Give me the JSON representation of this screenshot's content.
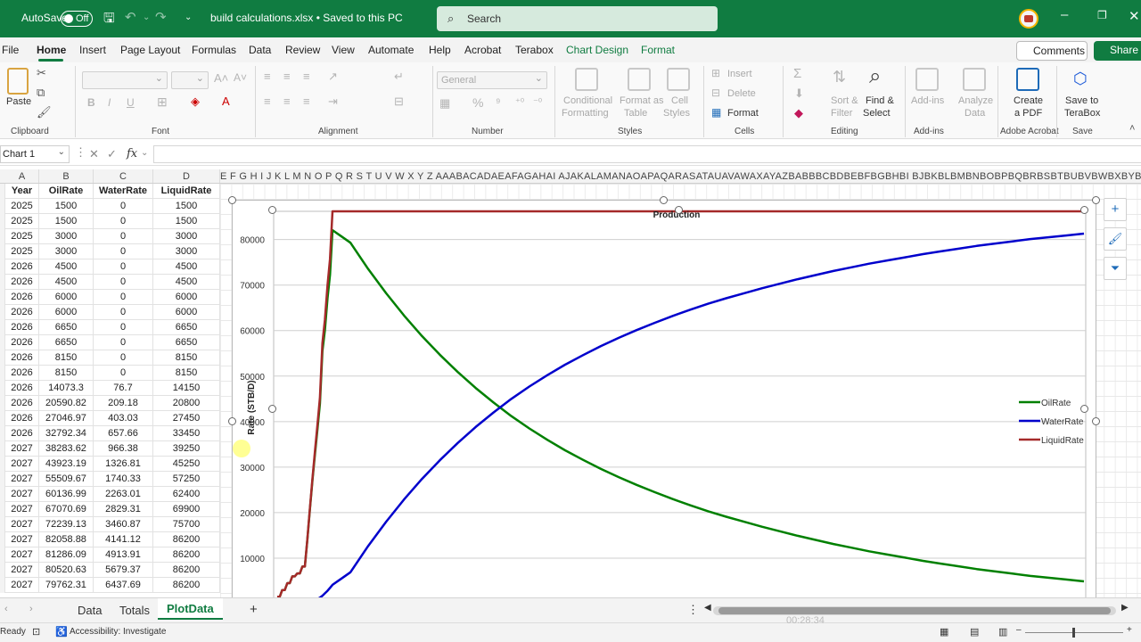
{
  "titlebar": {
    "autosave_label": "AutoSave",
    "autosave_state": "Off",
    "doc_title": "build calculations.xlsx • Saved to this PC",
    "search_placeholder": "Search",
    "brand_color": "#107c41"
  },
  "menu": {
    "tabs": [
      "File",
      "Home",
      "Insert",
      "Page Layout",
      "Formulas",
      "Data",
      "Review",
      "View",
      "Automate",
      "Help",
      "Acrobat",
      "Terabox",
      "Chart Design",
      "Format"
    ],
    "active_tab": "Home",
    "comments_label": "Comments",
    "share_label": "Share"
  },
  "ribbon": {
    "paste_label": "Paste",
    "number_format": "General",
    "conditional_formatting": [
      "Conditional",
      "Formatting"
    ],
    "format_as_table": [
      "Format as",
      "Table"
    ],
    "cell_styles": [
      "Cell",
      "Styles"
    ],
    "insert_label": "Insert",
    "delete_label": "Delete",
    "format_label": "Format",
    "sort_filter": [
      "Sort &",
      "Filter"
    ],
    "find_select": [
      "Find &",
      "Select"
    ],
    "add_ins": "Add-ins",
    "analyze_data": [
      "Analyze",
      "Data"
    ],
    "create_pdf": [
      "Create",
      "a PDF"
    ],
    "save_terabox": [
      "Save to",
      "TeraBox"
    ],
    "groups": {
      "clipboard": "Clipboard",
      "font": "Font",
      "alignment": "Alignment",
      "number": "Number",
      "styles": "Styles",
      "cells": "Cells",
      "editing": "Editing",
      "add_ins": "Add-ins",
      "adobe_acrobat": "Adobe Acrobat",
      "save": "Save"
    }
  },
  "formula_bar": {
    "name_box": "Chart 1",
    "fx": "fx"
  },
  "grid": {
    "columns": [
      "A",
      "B",
      "C",
      "D"
    ],
    "more_columns": "E F G H I J K L M N O P Q R S T U V W X Y Z AAABACADAEAFAGAHAI AJAKALAMANAOAPAQARASATAUAVAWAXAYAZBABBBCBDBEBFBGBHBI BJBKBLBMBNBOBPBQBRBSBTBUBVBWBXBYBZCACBCCCDCECFCGCHCI CJ",
    "header": [
      "Year",
      "OilRate",
      "WaterRate",
      "LiquidRate"
    ],
    "rows": [
      [
        "2025",
        "1500",
        "0",
        "1500"
      ],
      [
        "2025",
        "1500",
        "0",
        "1500"
      ],
      [
        "2025",
        "3000",
        "0",
        "3000"
      ],
      [
        "2025",
        "3000",
        "0",
        "3000"
      ],
      [
        "2026",
        "4500",
        "0",
        "4500"
      ],
      [
        "2026",
        "4500",
        "0",
        "4500"
      ],
      [
        "2026",
        "6000",
        "0",
        "6000"
      ],
      [
        "2026",
        "6000",
        "0",
        "6000"
      ],
      [
        "2026",
        "6650",
        "0",
        "6650"
      ],
      [
        "2026",
        "6650",
        "0",
        "6650"
      ],
      [
        "2026",
        "8150",
        "0",
        "8150"
      ],
      [
        "2026",
        "8150",
        "0",
        "8150"
      ],
      [
        "2026",
        "14073.3",
        "76.7",
        "14150"
      ],
      [
        "2026",
        "20590.82",
        "209.18",
        "20800"
      ],
      [
        "2026",
        "27046.97",
        "403.03",
        "27450"
      ],
      [
        "2026",
        "32792.34",
        "657.66",
        "33450"
      ],
      [
        "2027",
        "38283.62",
        "966.38",
        "39250"
      ],
      [
        "2027",
        "43923.19",
        "1326.81",
        "45250"
      ],
      [
        "2027",
        "55509.67",
        "1740.33",
        "57250"
      ],
      [
        "2027",
        "60136.99",
        "2263.01",
        "62400"
      ],
      [
        "2027",
        "67070.69",
        "2829.31",
        "69900"
      ],
      [
        "2027",
        "72239.13",
        "3460.87",
        "75700"
      ],
      [
        "2027",
        "82058.88",
        "4141.12",
        "86200"
      ],
      [
        "2027",
        "81286.09",
        "4913.91",
        "86200"
      ],
      [
        "2027",
        "80520.63",
        "5679.37",
        "86200"
      ],
      [
        "2027",
        "79762.31",
        "6437.69",
        "86200"
      ]
    ]
  },
  "chart_data": {
    "type": "line",
    "title": "Production",
    "ylabel": "Rate (STB/D)",
    "xlabel": "",
    "ylim": [
      0,
      86200
    ],
    "yticks": [
      10000,
      20000,
      30000,
      40000,
      50000,
      60000,
      70000,
      80000
    ],
    "legend_position": "right",
    "grid": true,
    "series": [
      {
        "name": "OilRate",
        "color": "#008000",
        "values": [
          1500,
          1500,
          3000,
          3000,
          4500,
          4500,
          6000,
          6000,
          6650,
          6650,
          8150,
          8150,
          14073.3,
          20590.82,
          27046.97,
          32792.34,
          38283.62,
          43923.19,
          55509.67,
          60136.99,
          67070.69,
          72239.13,
          82058.88,
          79300,
          73500,
          68200,
          63300,
          58800,
          54700,
          50900,
          47400,
          44200,
          41200,
          38500,
          36000,
          33700,
          31600,
          29600,
          27800,
          26100,
          24500,
          23000,
          21600,
          20300,
          19100,
          18000,
          16900,
          15900,
          14900,
          14000,
          13100,
          12300,
          11500,
          10800,
          10100,
          9400,
          8800,
          8200,
          7600,
          7100,
          6600,
          6100,
          5700,
          5300,
          4900
        ]
      },
      {
        "name": "WaterRate",
        "color": "#0000cc",
        "values": [
          0,
          0,
          0,
          0,
          0,
          0,
          0,
          0,
          0,
          0,
          0,
          0,
          76.7,
          209.18,
          403.03,
          657.66,
          966.38,
          1326.81,
          1740.33,
          2263.01,
          2829.31,
          3460.87,
          4141.12,
          6900,
          12700,
          18000,
          22900,
          27400,
          31500,
          35300,
          38800,
          42000,
          45000,
          47700,
          50200,
          52500,
          54600,
          56600,
          58400,
          60100,
          61700,
          63200,
          64600,
          65900,
          67100,
          68200,
          69300,
          70300,
          71300,
          72200,
          73100,
          73900,
          74700,
          75400,
          76100,
          76800,
          77400,
          78000,
          78600,
          79100,
          79600,
          80100,
          80500,
          80900,
          81300
        ]
      },
      {
        "name": "LiquidRate",
        "color": "#a52a2a",
        "values": [
          1500,
          1500,
          3000,
          3000,
          4500,
          4500,
          6000,
          6000,
          6650,
          6650,
          8150,
          8150,
          14150,
          20800,
          27450,
          33450,
          39250,
          45250,
          57250,
          62400,
          69900,
          75700,
          86200,
          86200,
          86200,
          86200,
          86200,
          86200,
          86200,
          86200,
          86200,
          86200,
          86200,
          86200,
          86200,
          86200,
          86200,
          86200,
          86200,
          86200,
          86200,
          86200,
          86200,
          86200,
          86200,
          86200,
          86200,
          86200,
          86200,
          86200,
          86200,
          86200,
          86200,
          86200,
          86200,
          86200,
          86200,
          86200,
          86200,
          86200,
          86200,
          86200,
          86200,
          86200,
          86200
        ]
      }
    ]
  },
  "sheets": {
    "tabs": [
      "Data",
      "Totals",
      "PlotData"
    ],
    "active": "PlotData",
    "add_icon": "+"
  },
  "status": {
    "ready": "Ready",
    "accessibility": "Accessibility: Investigate",
    "video_time": "00:28:34"
  }
}
